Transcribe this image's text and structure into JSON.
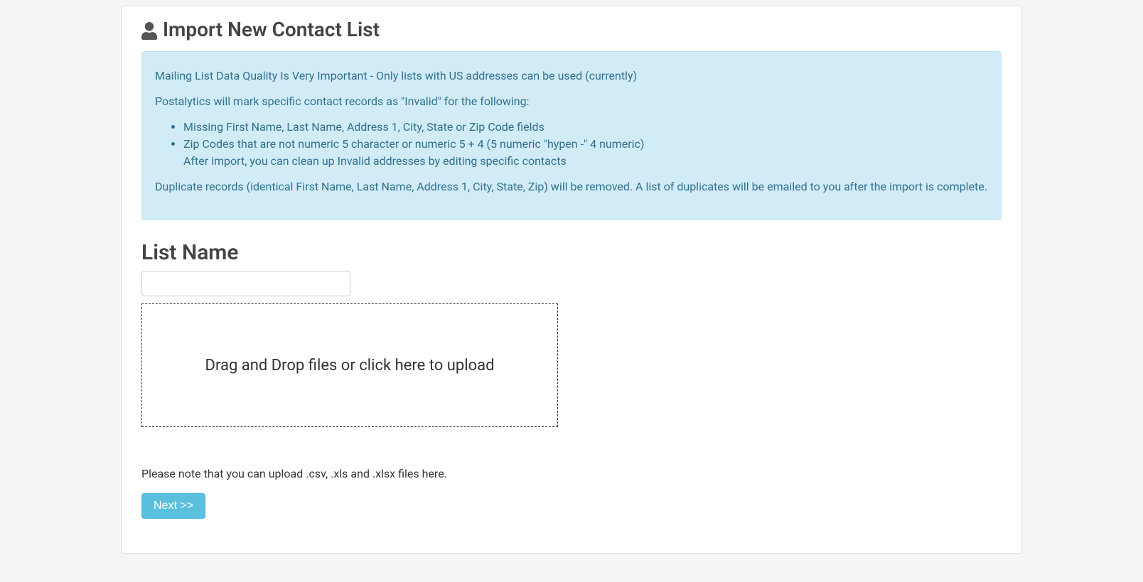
{
  "header": {
    "title": "Import New Contact List"
  },
  "alert": {
    "line1": "Mailing List Data Quality Is Very Important - Only lists with US addresses can be used (currently)",
    "line2": "Postalytics will mark specific contact records as \"Invalid\" for the following:",
    "bullets": [
      "Missing First Name, Last Name, Address 1, City, State or Zip Code fields",
      "Zip Codes that are not numeric 5 character or numeric 5 + 4 (5 numeric \"hypen -\" 4 numeric)"
    ],
    "bullet_subnote": "After import, you can clean up Invalid addresses by editing specific contacts",
    "line3": "Duplicate records (identical First Name, Last Name, Address 1, City, State, Zip) will be removed. A list of duplicates will be emailed to you after the import is complete."
  },
  "form": {
    "list_name_label": "List Name",
    "list_name_value": "",
    "dropzone_text": "Drag and Drop files or click here to upload",
    "upload_note": "Please note that you can upload .csv, .xls and .xlsx files here.",
    "next_button_label": "Next >>"
  }
}
